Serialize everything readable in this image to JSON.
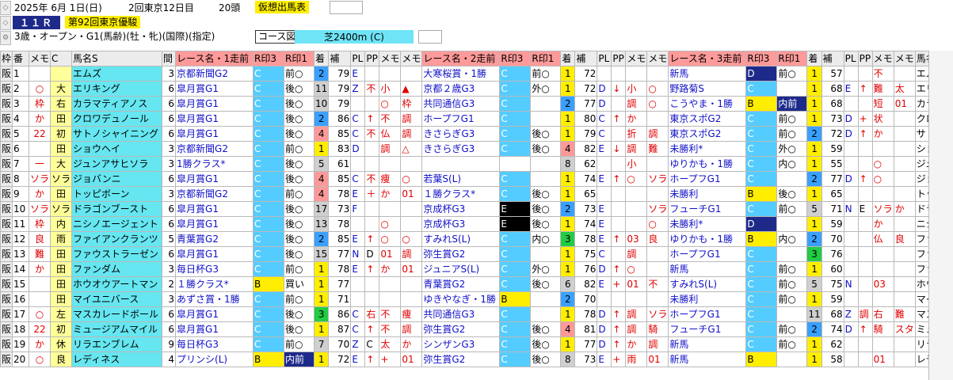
{
  "header": {
    "date": "2025年 6月 1日(日)",
    "meeting": "2回東京12日目",
    "field_size": "20頭",
    "mode": "仮想出馬表",
    "race_no": "１１Ｒ",
    "race_name": "第92回東京優駿",
    "conditions": "3歳・オープン・G1(馬齢)(牡・牝)(国際)(指定)",
    "course_label": "コース図",
    "course": "芝2400m (C)"
  },
  "columns": [
    "枠",
    "番",
    "メモ",
    "C",
    "馬名S",
    "間",
    "レース名・1走前",
    "R印3",
    "R印1",
    "着",
    "補",
    "PL",
    "PP",
    "メモ",
    "メモ",
    "レース名・2走前",
    "R印3",
    "R印1",
    "着",
    "補",
    "PL",
    "PP",
    "メモ",
    "メモ",
    "レース名・3走前",
    "R印3",
    "R印1",
    "着",
    "補",
    "PL",
    "PP",
    "メモ",
    "メモ",
    "馬名"
  ],
  "colors": {
    "accent": "#1e2a8a",
    "cyan": "#55ccff",
    "yellow": "#ffee00",
    "header_red": "#ff9a9a",
    "name_cyan": "#66e6f0"
  },
  "rows": [
    {
      "w": "阪",
      "n": "1",
      "m": "",
      "c": "",
      "name": "エムズ",
      "iv": "3",
      "r1": "京都新聞G2",
      "r1a": "C",
      "r1b": "前○",
      "r1p": "2",
      "r1h": "79",
      "r1pl": "E",
      "r1pp": "",
      "r1m1": "",
      "r1m2": "",
      "r2": "大寒桜賞・1勝",
      "r2a": "C",
      "r2b": "前○",
      "r2p": "1",
      "r2h": "72",
      "r2pl": "",
      "r2pp": "",
      "r2m1": "",
      "r2m2": "",
      "r3": "新馬",
      "r3a": "D",
      "r3b": "前○",
      "r3p": "1",
      "r3h": "57",
      "r3pl": "",
      "r3pp": "",
      "r3m1": "不",
      "r3m2": "",
      "tail": "エム"
    },
    {
      "w": "阪",
      "n": "2",
      "m": "○",
      "c": "大",
      "name": "エリキング",
      "iv": "6",
      "r1": "皐月賞G1",
      "r1a": "C",
      "r1b": "後○",
      "r1p": "11",
      "r1h": "79",
      "r1pl": "Z",
      "r1pp": "不",
      "r1m1": "小",
      "r1m2": "▲",
      "r2": "京都２歳G3",
      "r2a": "C",
      "r2b": "外○",
      "r2p": "1",
      "r2h": "72",
      "r2pl": "D",
      "r2pp": "↓",
      "r2m1": "小",
      "r2m2": "○",
      "r3": "野路菊S",
      "r3a": "C",
      "r3b": "",
      "r3p": "1",
      "r3h": "68",
      "r3pl": "E",
      "r3pp": "↑",
      "r3m1": "難",
      "r3m2": "太",
      "tail": "エリキ"
    },
    {
      "w": "阪",
      "n": "3",
      "m": "枠",
      "c": "右",
      "name": "カラマティアノス",
      "iv": "6",
      "r1": "皐月賞G1",
      "r1a": "C",
      "r1b": "後○",
      "r1p": "10",
      "r1h": "79",
      "r1pl": "",
      "r1pp": "",
      "r1m1": "○",
      "r1m2": "枠",
      "r2": "共同通信G3",
      "r2a": "C",
      "r2b": "",
      "r2p": "2",
      "r2h": "77",
      "r2pl": "D",
      "r2pp": "",
      "r2m1": "調",
      "r2m2": "○",
      "r3": "こうやま・1勝",
      "r3a": "B",
      "r3b": "内前",
      "r3p": "1",
      "r3h": "68",
      "r3pl": "",
      "r3pp": "",
      "r3m1": "短",
      "r3m2": "01",
      "tail": "カラマ"
    },
    {
      "w": "阪",
      "n": "4",
      "m": "か",
      "c": "田",
      "name": "クロワデュノール",
      "iv": "6",
      "r1": "皐月賞G1",
      "r1a": "C",
      "r1b": "後○",
      "r1p": "2",
      "r1h": "86",
      "r1pl": "C",
      "r1pp": "↑",
      "r1m1": "不",
      "r1m2": "調",
      "r2": "ホープフG1",
      "r2a": "C",
      "r2b": "",
      "r2p": "1",
      "r2h": "80",
      "r2pl": "C",
      "r2pp": "↑",
      "r2m1": "か",
      "r2m2": "",
      "r3": "東京スポG2",
      "r3a": "C",
      "r3b": "前○",
      "r3p": "1",
      "r3h": "73",
      "r3pl": "D",
      "r3pp": "+",
      "r3m1": "状",
      "r3m2": "",
      "tail": "クロワ"
    },
    {
      "w": "阪",
      "n": "5",
      "m": "22",
      "c": "初",
      "name": "サトノシャイニング",
      "iv": "6",
      "r1": "皐月賞G1",
      "r1a": "C",
      "r1b": "後○",
      "r1p": "4",
      "r1h": "85",
      "r1pl": "C",
      "r1pp": "不",
      "r1m1": "仏",
      "r1m2": "調",
      "r2": "きさらぎG3",
      "r2a": "C",
      "r2b": "後○",
      "r2p": "1",
      "r2h": "79",
      "r2pl": "C",
      "r2pp": "",
      "r2m1": "折",
      "r2m2": "調",
      "r3": "東京スポG2",
      "r3a": "C",
      "r3b": "前○",
      "r3p": "2",
      "r3h": "72",
      "r3pl": "D",
      "r3pp": "↑",
      "r3m1": "か",
      "r3m2": "",
      "tail": "サトノ"
    },
    {
      "w": "阪",
      "n": "6",
      "m": "",
      "c": "田",
      "name": "ショウヘイ",
      "iv": "3",
      "r1": "京都新聞G2",
      "r1a": "C",
      "r1b": "前○",
      "r1p": "1",
      "r1h": "83",
      "r1pl": "D",
      "r1pp": "",
      "r1m1": "調",
      "r1m2": "△",
      "r2": "きさらぎG3",
      "r2a": "C",
      "r2b": "後○",
      "r2p": "4",
      "r2h": "82",
      "r2pl": "E",
      "r2pp": "↓",
      "r2m1": "調",
      "r2m2": "難",
      "r3": "未勝利*",
      "r3a": "C",
      "r3b": "外○",
      "r3p": "1",
      "r3h": "59",
      "r3pl": "",
      "r3pp": "",
      "r3m1": "",
      "r3m2": "",
      "tail": "ショウ"
    },
    {
      "w": "阪",
      "n": "7",
      "m": "一",
      "c": "大",
      "name": "ジュンアサヒソラ",
      "iv": "3",
      "r1": "1勝クラス*",
      "r1a": "C",
      "r1b": "後○",
      "r1p": "5",
      "r1h": "61",
      "r1pl": "",
      "r1pp": "",
      "r1m1": "",
      "r1m2": "",
      "r2": "",
      "r2a": "",
      "r2b": "",
      "r2p": "8",
      "r2h": "62",
      "r2pl": "",
      "r2pp": "",
      "r2m1": "小",
      "r2m2": "",
      "r3": "ゆりかも・1勝",
      "r3a": "C",
      "r3b": "内○",
      "r3p": "1",
      "r3h": "55",
      "r3pl": "",
      "r3pp": "",
      "r3m1": "○",
      "r3m2": "",
      "tail": "ジュン"
    },
    {
      "w": "阪",
      "n": "8",
      "m": "ソラ",
      "c": "ソラ",
      "name": "ジョバンニ",
      "iv": "6",
      "r1": "皐月賞G1",
      "r1a": "C",
      "r1b": "後○",
      "r1p": "4",
      "r1h": "85",
      "r1pl": "C",
      "r1pp": "不",
      "r1m1": "痩",
      "r1m2": "○",
      "r2": "若葉S(L)",
      "r2a": "C",
      "r2b": "",
      "r2p": "1",
      "r2h": "74",
      "r2pl": "E",
      "r2pp": "↑",
      "r2m1": "○",
      "r2m2": "ソラ",
      "r3": "ホープフG1",
      "r3a": "C",
      "r3b": "",
      "r3p": "2",
      "r3h": "77",
      "r3pl": "D",
      "r3pp": "↑",
      "r3m1": "○",
      "r3m2": "",
      "tail": "ジョバ"
    },
    {
      "w": "阪",
      "n": "9",
      "m": "か",
      "c": "田",
      "name": "トッピボーン",
      "iv": "3",
      "r1": "京都新聞G2",
      "r1a": "C",
      "r1b": "前○",
      "r1p": "4",
      "r1h": "78",
      "r1pl": "E",
      "r1pp": "＋",
      "r1m1": "か",
      "r1m2": "01",
      "r2": "１勝クラス*",
      "r2a": "C",
      "r2b": "後○",
      "r2p": "1",
      "r2h": "65",
      "r2pl": "",
      "r2pp": "",
      "r2m1": "",
      "r2m2": "",
      "r3": "未勝利",
      "r3a": "B",
      "r3b": "後○",
      "r3p": "1",
      "r3h": "65",
      "r3pl": "",
      "r3pp": "",
      "r3m1": "",
      "r3m2": "",
      "tail": "トッピ"
    },
    {
      "w": "阪",
      "n": "10",
      "m": "ソラ",
      "c": "ソラ",
      "name": "ドラゴンブースト",
      "iv": "6",
      "r1": "皐月賞G1",
      "r1a": "C",
      "r1b": "後○",
      "r1p": "17",
      "r1h": "73",
      "r1pl": "F",
      "r1pp": "",
      "r1m1": "",
      "r1m2": "",
      "r2": "京成杯G3",
      "r2a": "E",
      "r2b": "後○",
      "r2p": "2",
      "r2h": "73",
      "r2pl": "E",
      "r2pp": "",
      "r2m1": "",
      "r2m2": "ソラ",
      "r3": "フューチG1",
      "r3a": "C",
      "r3b": "前○",
      "r3p": "5",
      "r3h": "71",
      "r3pl": "N",
      "r3pp": "E",
      "r3m1": "ソラ",
      "r3m2": "か",
      "tail": "ドラゴ"
    },
    {
      "w": "阪",
      "n": "11",
      "m": "枠",
      "c": "内",
      "name": "ニシノエージェント",
      "iv": "6",
      "r1": "皐月賞G1",
      "r1a": "C",
      "r1b": "後○",
      "r1p": "13",
      "r1h": "78",
      "r1pl": "",
      "r1pp": "",
      "r1m1": "○",
      "r1m2": "",
      "r2": "京成杯G3",
      "r2a": "E",
      "r2b": "後○",
      "r2p": "1",
      "r2h": "74",
      "r2pl": "E",
      "r2pp": "",
      "r2m1": "",
      "r2m2": "○",
      "r3": "未勝利*",
      "r3a": "D",
      "r3b": "",
      "r3p": "1",
      "r3h": "59",
      "r3pl": "",
      "r3pp": "",
      "r3m1": "か",
      "r3m2": "",
      "tail": "ニシノ"
    },
    {
      "w": "阪",
      "n": "12",
      "m": "良",
      "c": "雨",
      "name": "ファイアンクランツ",
      "iv": "5",
      "r1": "青葉賞G2",
      "r1a": "C",
      "r1b": "後○",
      "r1p": "2",
      "r1h": "85",
      "r1pl": "E",
      "r1pp": "↑",
      "r1m1": "○",
      "r1m2": "○",
      "r2": "すみれS(L)",
      "r2a": "C",
      "r2b": "内○",
      "r2p": "3",
      "r2h": "78",
      "r2pl": "E",
      "r2pp": "↑",
      "r2m1": "03",
      "r2m2": "良",
      "r3": "ゆりかも・1勝",
      "r3a": "B",
      "r3b": "内○",
      "r3p": "2",
      "r3h": "70",
      "r3pl": "",
      "r3pp": "",
      "r3m1": "仏",
      "r3m2": "良",
      "tail": "ファイ"
    },
    {
      "w": "阪",
      "n": "13",
      "m": "難",
      "c": "田",
      "name": "ファウストラーゼン",
      "iv": "6",
      "r1": "皐月賞G1",
      "r1a": "C",
      "r1b": "後○",
      "r1p": "15",
      "r1h": "77",
      "r1pl": "N",
      "r1pp": "D",
      "r1m1": "01",
      "r1m2": "調",
      "r2": "弥生賞G2",
      "r2a": "C",
      "r2b": "",
      "r2p": "1",
      "r2h": "75",
      "r2pl": "C",
      "r2pp": "",
      "r2m1": "調",
      "r2m2": "",
      "r3": "ホープフG1",
      "r3a": "C",
      "r3b": "",
      "r3p": "3",
      "r3h": "76",
      "r3pl": "",
      "r3pp": "",
      "r3m1": "",
      "r3m2": "",
      "tail": "ファウ"
    },
    {
      "w": "阪",
      "n": "14",
      "m": "か",
      "c": "田",
      "name": "ファンダム",
      "iv": "3",
      "r1": "毎日杯G3",
      "r1a": "C",
      "r1b": "前○",
      "r1p": "1",
      "r1h": "78",
      "r1pl": "E",
      "r1pp": "↑",
      "r1m1": "か",
      "r1m2": "01",
      "r2": "ジュニアS(L)",
      "r2a": "C",
      "r2b": "外○",
      "r2p": "1",
      "r2h": "76",
      "r2pl": "D",
      "r2pp": "↑",
      "r2m1": "○",
      "r2m2": "",
      "r3": "新馬",
      "r3a": "C",
      "r3b": "前○",
      "r3p": "1",
      "r3h": "60",
      "r3pl": "",
      "r3pp": "",
      "r3m1": "",
      "r3m2": "",
      "tail": "ファン"
    },
    {
      "w": "阪",
      "n": "15",
      "m": "",
      "c": "田",
      "name": "ホウオウアートマン",
      "iv": "2",
      "r1": "１勝クラス*",
      "r1a": "B",
      "r1b": "買い",
      "r1p": "1",
      "r1h": "77",
      "r1pl": "",
      "r1pp": "",
      "r1m1": "",
      "r1m2": "",
      "r2": "青葉賞G2",
      "r2a": "C",
      "r2b": "後○",
      "r2p": "6",
      "r2h": "82",
      "r2pl": "E",
      "r2pp": "+",
      "r2m1": "01",
      "r2m2": "不",
      "r3": "すみれS(L)",
      "r3a": "C",
      "r3b": "前○",
      "r3p": "5",
      "r3h": "75",
      "r3pl": "N",
      "r3pp": "",
      "r3m1": "03",
      "r3m2": "",
      "tail": "ホウオ"
    },
    {
      "w": "阪",
      "n": "16",
      "m": "",
      "c": "田",
      "name": "マイユニバース",
      "iv": "3",
      "r1": "あずさ賞・1勝",
      "r1a": "C",
      "r1b": "前○",
      "r1p": "1",
      "r1h": "71",
      "r1pl": "",
      "r1pp": "",
      "r1m1": "",
      "r1m2": "",
      "r2": "ゆきやなぎ・1勝",
      "r2a": "B",
      "r2b": "",
      "r2p": "2",
      "r2h": "70",
      "r2pl": "",
      "r2pp": "",
      "r2m1": "",
      "r2m2": "",
      "r3": "未勝利",
      "r3a": "C",
      "r3b": "前○",
      "r3p": "1",
      "r3h": "59",
      "r3pl": "",
      "r3pp": "",
      "r3m1": "",
      "r3m2": "",
      "tail": "マイユ"
    },
    {
      "w": "阪",
      "n": "17",
      "m": "○",
      "c": "左",
      "name": "マスカレードボール",
      "iv": "6",
      "r1": "皐月賞G1",
      "r1a": "C",
      "r1b": "後○",
      "r1p": "3",
      "r1h": "86",
      "r1pl": "C",
      "r1pp": "右",
      "r1m1": "不",
      "r1m2": "痩",
      "r2": "共同通信G3",
      "r2a": "C",
      "r2b": "",
      "r2p": "1",
      "r2h": "78",
      "r2pl": "D",
      "r2pp": "↑",
      "r2m1": "調",
      "r2m2": "ソラ",
      "r3": "ホープフG1",
      "r3a": "C",
      "r3b": "",
      "r3p": "11",
      "r3h": "68",
      "r3pl": "Z",
      "r3pp": "調",
      "r3m1": "右",
      "r3m2": "難",
      "tail": "マスカ"
    },
    {
      "w": "阪",
      "n": "18",
      "m": "22",
      "c": "初",
      "name": "ミュージアムマイル",
      "iv": "6",
      "r1": "皐月賞G1",
      "r1a": "C",
      "r1b": "後○",
      "r1p": "1",
      "r1h": "87",
      "r1pl": "C",
      "r1pp": "↑",
      "r1m1": "不",
      "r1m2": "調",
      "r2": "弥生賞G2",
      "r2a": "C",
      "r2b": "後○",
      "r2p": "4",
      "r2h": "81",
      "r2pl": "D",
      "r2pp": "↑",
      "r2m1": "調",
      "r2m2": "騎",
      "r3": "フューチG1",
      "r3a": "C",
      "r3b": "前○",
      "r3p": "2",
      "r3h": "74",
      "r3pl": "D",
      "r3pp": "↑",
      "r3m1": "騎",
      "r3m2": "スタ",
      "tail": "ミュー"
    },
    {
      "w": "阪",
      "n": "19",
      "m": "か",
      "c": "休",
      "name": "リラエンブレム",
      "iv": "9",
      "r1": "毎日杯G3",
      "r1a": "C",
      "r1b": "前○",
      "r1p": "7",
      "r1h": "70",
      "r1pl": "Z",
      "r1pp": "C",
      "r1m1": "太",
      "r1m2": "か",
      "r2": "シンザンG3",
      "r2a": "C",
      "r2b": "後○",
      "r2p": "1",
      "r2h": "77",
      "r2pl": "D",
      "r2pp": "↑",
      "r2m1": "か",
      "r2m2": "調",
      "r3": "新馬",
      "r3a": "C",
      "r3b": "前○",
      "r3p": "1",
      "r3h": "62",
      "r3pl": "",
      "r3pp": "",
      "r3m1": "",
      "r3m2": "",
      "tail": "リラエ"
    },
    {
      "w": "阪",
      "n": "20",
      "m": "○",
      "c": "良",
      "name": "レディネス",
      "iv": "4",
      "r1": "プリンシ(L)",
      "r1a": "B",
      "r1b": "内前",
      "r1p": "1",
      "r1h": "72",
      "r1pl": "E",
      "r1pp": "↑",
      "r1m1": "+",
      "r1m2": "01",
      "r2": "弥生賞G2",
      "r2a": "C",
      "r2b": "後○",
      "r2p": "8",
      "r2h": "73",
      "r2pl": "E",
      "r2pp": "+",
      "r2m1": "雨",
      "r2m2": "01",
      "r3": "新馬",
      "r3a": "B",
      "r3b": "",
      "r3p": "1",
      "r3h": "58",
      "r3pl": "",
      "r3pp": "",
      "r3m1": "01",
      "r3m2": "",
      "tail": "レディ"
    }
  ]
}
